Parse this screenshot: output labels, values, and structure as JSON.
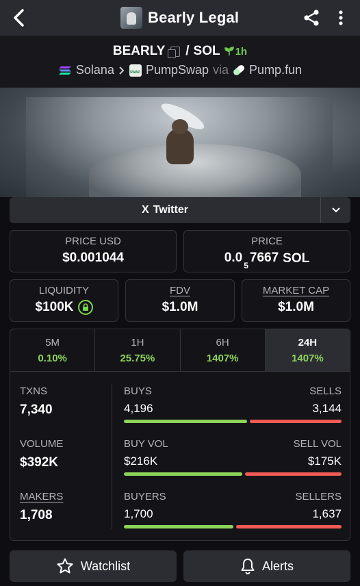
{
  "header": {
    "title": "Bearly Legal",
    "icons": {
      "back": "chevron-left-icon",
      "share": "share-icon",
      "more": "more-vertical-icon"
    }
  },
  "pair": {
    "base": "BEARLY",
    "slash": "/",
    "quote": "SOL",
    "age": "1h",
    "chain": "Solana",
    "dex": "PumpSwap",
    "via_label": "via",
    "launchpad": "Pump.fun"
  },
  "links": {
    "twitter": "Twitter",
    "twitter_x": "X"
  },
  "price": {
    "usd_label": "PRICE USD",
    "usd_value": "$0.001044",
    "native_label": "PRICE",
    "native_prefix": "0.0",
    "native_zeros": "5",
    "native_digits": "7667",
    "native_unit": "SOL"
  },
  "summary": {
    "liquidity_label": "LIQUIDITY",
    "liquidity_value": "$100K",
    "fdv_label": "FDV",
    "fdv_value": "$1.0M",
    "mcap_label": "MARKET CAP",
    "mcap_value": "$1.0M"
  },
  "timeframes": [
    {
      "label": "5M",
      "change": "0.10%"
    },
    {
      "label": "1H",
      "change": "25.75%"
    },
    {
      "label": "6H",
      "change": "1407%"
    },
    {
      "label": "24H",
      "change": "1407%",
      "active": true
    }
  ],
  "metrics": {
    "txns_label": "TXNS",
    "txns_value": "7,340",
    "volume_label": "VOLUME",
    "volume_value": "$392K",
    "makers_label": "MAKERS",
    "makers_value": "1,708",
    "buys_label": "BUYS",
    "buys_value": "4,196",
    "sells_label": "SELLS",
    "sells_value": "3,144",
    "buyvol_label": "BUY VOL",
    "buyvol_value": "$216K",
    "sellvol_label": "SELL VOL",
    "sellvol_value": "$175K",
    "buyers_label": "BUYERS",
    "buyers_value": "1,700",
    "sellers_label": "SELLERS",
    "sellers_value": "1,637",
    "ratios": {
      "buys": 0.572,
      "buy_vol": 0.552,
      "buyers": 0.509
    }
  },
  "actions": {
    "watchlist": "Watchlist",
    "alerts": "Alerts"
  },
  "colors": {
    "positive": "#8cd45a",
    "negative": "#ef5a55",
    "panel": "#2c2c33"
  }
}
